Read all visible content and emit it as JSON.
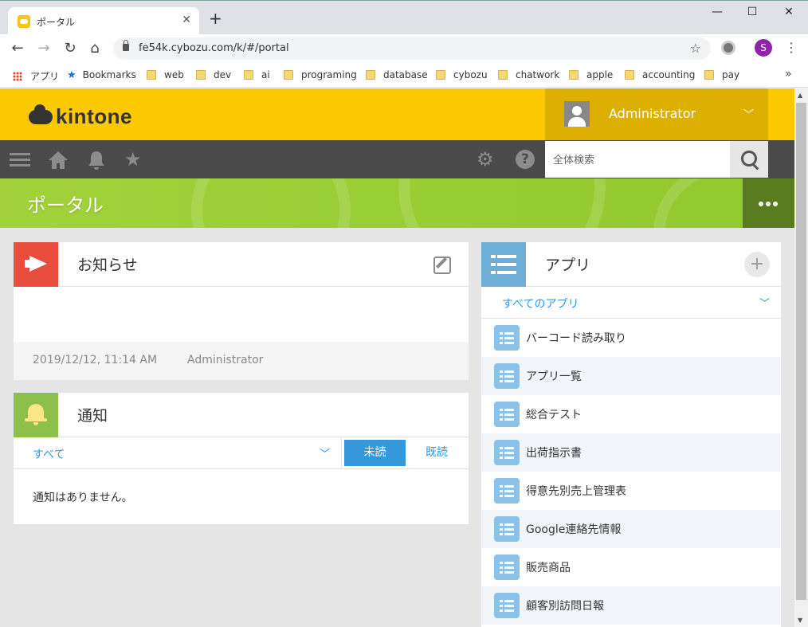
{
  "browser": {
    "tab_title": "ポータル",
    "tab_close": "✕",
    "new_tab": "+",
    "window_min": "—",
    "window_max": "☐",
    "window_close": "✕",
    "url": "fe54k.cybozu.com/k/#/portal",
    "profile_initial": "S",
    "bookmarks": [
      "アプリ",
      "Bookmarks",
      "web",
      "dev",
      "ai",
      "programing",
      "database",
      "cybozu",
      "chatwork",
      "apple",
      "accounting",
      "pay"
    ],
    "bookmarks_more": "»"
  },
  "header": {
    "logo": "kintone",
    "username": "Administrator",
    "user_chevron": "﹀"
  },
  "search": {
    "placeholder": "全体検索"
  },
  "banner": {
    "title": "ポータル"
  },
  "notice": {
    "title": "お知らせ",
    "date": "2019/12/12, 11:14 AM",
    "author": "Administrator"
  },
  "notifications": {
    "title": "通知",
    "filter": "すべて",
    "filter_chevron": "﹀",
    "unread": "未読",
    "read": "既読",
    "empty": "通知はありません。"
  },
  "apps": {
    "title": "アプリ",
    "add": "+",
    "filter": "すべてのアプリ",
    "filter_chevron": "﹀",
    "items": [
      "バーコード読み取り",
      "アプリ一覧",
      "総合テスト",
      "出荷指示書",
      "得意先別売上管理表",
      "Google連絡先情報",
      "販売商品",
      "顧客別訪問日報"
    ]
  },
  "colors": {
    "brand_yellow": "#fcc800",
    "portal_green": "#a1d23b",
    "accent_blue": "#3498db"
  }
}
